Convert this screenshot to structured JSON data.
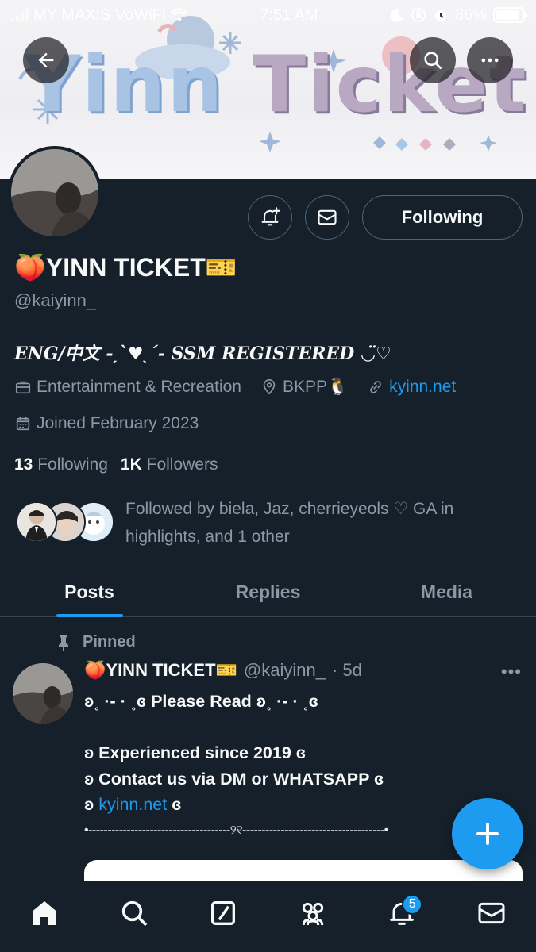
{
  "status_bar": {
    "carrier": "MY MAXIS VoWiFi",
    "time": "7:51 AM",
    "battery": "86%",
    "battery_level": 0.86
  },
  "banner": {
    "title_part1": "Yinn",
    "title_part2": "Ticket"
  },
  "profile": {
    "display_name": "🍑YINN TICKET🎫",
    "handle": "@kaiyinn_",
    "bio": "ENG/中文 -ˏˋ♥ˎˊ- SSM REGISTERED ◡̈♡",
    "category": "Entertainment & Recreation",
    "location": "BKPP🐧",
    "website": "kyinn.net",
    "joined": "Joined February 2023",
    "following_count": "13",
    "following_label": "Following",
    "followers_count": "1K",
    "followers_label": "Followers",
    "followed_by": "Followed by biela, Jaz, cherrieyeols ♡ GA in highlights, and 1 other",
    "follow_button": "Following"
  },
  "tabs": [
    {
      "label": "Posts",
      "active": true
    },
    {
      "label": "Replies",
      "active": false
    },
    {
      "label": "Media",
      "active": false
    }
  ],
  "pinned_post": {
    "pinned_label": "Pinned",
    "author_name": "🍑YINN TICKET🎫",
    "author_handle": "@kaiyinn_",
    "time": "· 5d",
    "more": "•••",
    "lines": [
      "ʚ˳ ·- · ˳ɞ Please Read ʚ˳ ·- · ˳ɞ",
      "",
      "ʚ Experienced since 2019 ɞ",
      "ʚ Contact us via DM or WHATSAPP ɞ"
    ],
    "link_prefix": "ʚ ",
    "link": "kyinn.net",
    "link_suffix": " ɞ",
    "divider": "•-------------------------------------୨୧-------------------------------------•"
  },
  "bottom_nav": {
    "notifications_badge": "5"
  },
  "icons": {
    "back": "back-arrow-icon",
    "search": "search-icon",
    "more": "more-icon",
    "notify": "bell-plus-icon",
    "message": "envelope-icon",
    "category": "briefcase-icon",
    "location": "location-pin-icon",
    "link": "link-icon",
    "calendar": "calendar-icon",
    "pin": "pin-icon",
    "compose": "plus-icon"
  },
  "colors": {
    "background": "#15202b",
    "accent": "#1d9bf0",
    "secondary_text": "#8b98a5",
    "border": "#38444d"
  }
}
